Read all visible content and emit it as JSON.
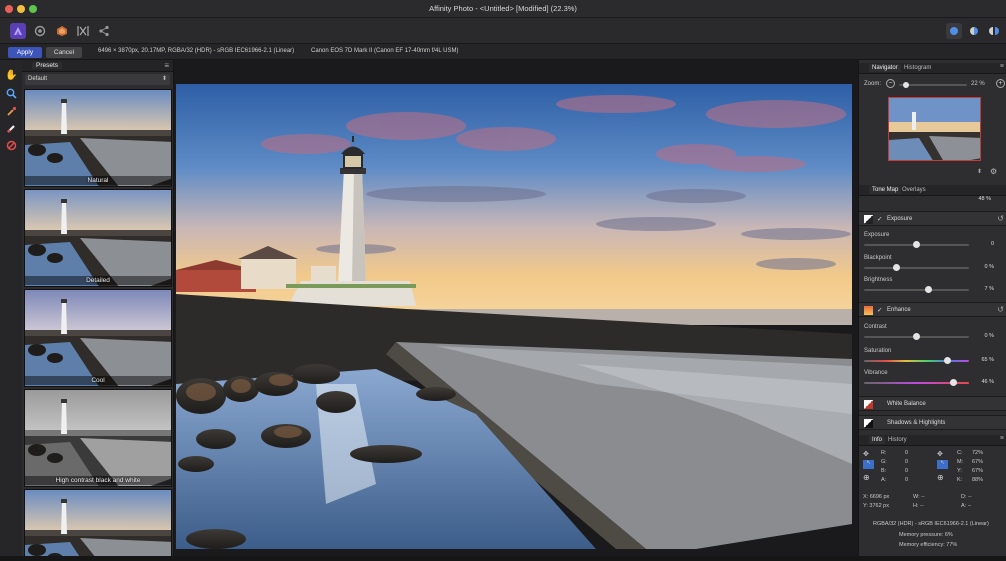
{
  "window": {
    "title": "Affinity Photo - <Untitled> [Modified] (22.3%)"
  },
  "colors": {
    "accent": "#4f6fd8",
    "apply_btn": "#3d55b8",
    "traffic_red": "#ec5f57",
    "traffic_yellow": "#f5be3d",
    "traffic_green": "#5dc74a"
  },
  "toolbar": {
    "left_icons": [
      "affinity-logo-icon",
      "develop-persona-icon",
      "tone-map-persona-icon",
      "liquify-persona-icon",
      "export-persona-icon"
    ],
    "right_icons": [
      "view-mode-icon",
      "split-view-icon",
      "mirror-view-icon"
    ]
  },
  "context": {
    "apply": "Apply",
    "cancel": "Cancel",
    "image_info": "6496 × 3870px, 20.17MP, RGBA/32 (HDR) - sRGB IEC61966-2.1 (Linear)",
    "camera_info": "Canon EOS 7D Mark II (Canon EF 17-40mm f/4L USM)"
  },
  "tools": [
    "hand-icon",
    "zoom-icon",
    "eyedropper-icon",
    "brush-icon",
    "erase-icon"
  ],
  "presets": {
    "tab": "Presets",
    "selected": "Default",
    "items": [
      "Natural",
      "Detailed",
      "Cool",
      "High contrast black and white",
      ""
    ]
  },
  "navigator": {
    "tabs": [
      "Navigator",
      "Histogram"
    ],
    "zoom_label": "Zoom:",
    "zoom_value": "22 %"
  },
  "tonemap": {
    "tabs": [
      "Tone Map",
      "Overlays"
    ],
    "top_value": "48 %",
    "exposure_section": "Exposure",
    "exposure": {
      "label": "Exposure",
      "value": "0",
      "level": 0.5
    },
    "blackpoint": {
      "label": "Blackpoint",
      "value": "0 %",
      "level": 0.3
    },
    "brightness": {
      "label": "Brightness",
      "value": "7 %",
      "level": 0.62
    },
    "enhance_section": "Enhance",
    "contrast": {
      "label": "Contrast",
      "value": "0 %",
      "level": 0.5
    },
    "saturation": {
      "label": "Saturation",
      "value": "65 %",
      "level": 0.82
    },
    "vibrance": {
      "label": "Vibrance",
      "value": "46 %",
      "level": 0.88
    },
    "white_balance": "White Balance",
    "shadows_highlights": "Shadows & Highlights"
  },
  "info": {
    "tabs": [
      "Info",
      "History"
    ],
    "left_labels": [
      "R:",
      "G:",
      "B:",
      "A:"
    ],
    "left_values": [
      "0",
      "0",
      "0",
      "0"
    ],
    "right_labels": [
      "C:",
      "M:",
      "Y:",
      "K:"
    ],
    "right_values": [
      "72%",
      "67%",
      "67%",
      "88%"
    ],
    "x": "X: 6696 px",
    "y": "Y: 3762 px",
    "w": "W: --",
    "h": "H: --",
    "d": "D: --",
    "angle": "A: --",
    "color_profile": "RGBA/32 (HDR) - sRGB IEC61966-2.1 (Linear)",
    "memory_pressure": "Memory pressure: 6%",
    "memory_efficiency": "Memory efficiency: 77%"
  }
}
